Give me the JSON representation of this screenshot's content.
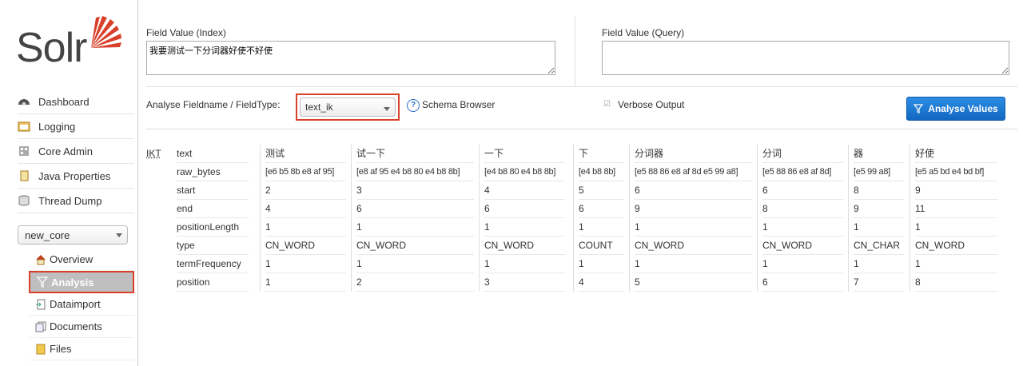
{
  "sidebar": {
    "logo_text": "Solr",
    "nav": [
      {
        "label": "Dashboard",
        "icon": "dashboard-icon"
      },
      {
        "label": "Logging",
        "icon": "logging-icon"
      },
      {
        "label": "Core Admin",
        "icon": "core-admin-icon"
      },
      {
        "label": "Java Properties",
        "icon": "java-properties-icon"
      },
      {
        "label": "Thread Dump",
        "icon": "thread-dump-icon"
      }
    ],
    "core_selector": "new_core",
    "core_nav": [
      {
        "label": "Overview",
        "icon": "home-icon"
      },
      {
        "label": "Analysis",
        "icon": "filter-icon",
        "active": true
      },
      {
        "label": "Dataimport",
        "icon": "dataimport-icon"
      },
      {
        "label": "Documents",
        "icon": "documents-icon"
      },
      {
        "label": "Files",
        "icon": "folder-icon"
      }
    ]
  },
  "form": {
    "index_label": "Field Value (Index)",
    "index_value": "我要测试一下分词器好使不好使",
    "query_label": "Field Value (Query)",
    "query_value": "",
    "fieldname_label": "Analyse Fieldname / FieldType:",
    "fieldtype_value": "text_ik",
    "schema_browser": "Schema Browser",
    "verbose_label": "Verbose Output",
    "verbose_checked": true,
    "analyse_button": "Analyse Values"
  },
  "analysis": {
    "tokenizer_abbr": "IKT",
    "row_labels": [
      "text",
      "raw_bytes",
      "start",
      "end",
      "positionLength",
      "type",
      "termFrequency",
      "position"
    ],
    "tokens": [
      {
        "text": "测试",
        "raw_bytes": "[e6 b5 8b e8 af 95]",
        "start": "2",
        "end": "4",
        "positionLength": "1",
        "type": "CN_WORD",
        "termFrequency": "1",
        "position": "1"
      },
      {
        "text": "试一下",
        "raw_bytes": "[e8 af 95 e4 b8 80 e4 b8 8b]",
        "start": "3",
        "end": "6",
        "positionLength": "1",
        "type": "CN_WORD",
        "termFrequency": "1",
        "position": "2"
      },
      {
        "text": "一下",
        "raw_bytes": "[e4 b8 80 e4 b8 8b]",
        "start": "4",
        "end": "6",
        "positionLength": "1",
        "type": "CN_WORD",
        "termFrequency": "1",
        "position": "3"
      },
      {
        "text": "下",
        "raw_bytes": "[e4 b8 8b]",
        "start": "5",
        "end": "6",
        "positionLength": "1",
        "type": "COUNT",
        "termFrequency": "1",
        "position": "4"
      },
      {
        "text": "分词器",
        "raw_bytes": "[e5 88 86 e8 af 8d e5 99 a8]",
        "start": "6",
        "end": "9",
        "positionLength": "1",
        "type": "CN_WORD",
        "termFrequency": "1",
        "position": "5"
      },
      {
        "text": "分词",
        "raw_bytes": "[e5 88 86 e8 af 8d]",
        "start": "6",
        "end": "8",
        "positionLength": "1",
        "type": "CN_WORD",
        "termFrequency": "1",
        "position": "6"
      },
      {
        "text": "器",
        "raw_bytes": "[e5 99 a8]",
        "start": "8",
        "end": "9",
        "positionLength": "1",
        "type": "CN_CHAR",
        "termFrequency": "1",
        "position": "7"
      },
      {
        "text": "好使",
        "raw_bytes": "[e5 a5 bd e4 bd bf]",
        "start": "9",
        "end": "11",
        "positionLength": "1",
        "type": "CN_WORD",
        "termFrequency": "1",
        "position": "8"
      }
    ]
  },
  "colors": {
    "accent": "#d9402b",
    "button": "#1a77d4"
  }
}
